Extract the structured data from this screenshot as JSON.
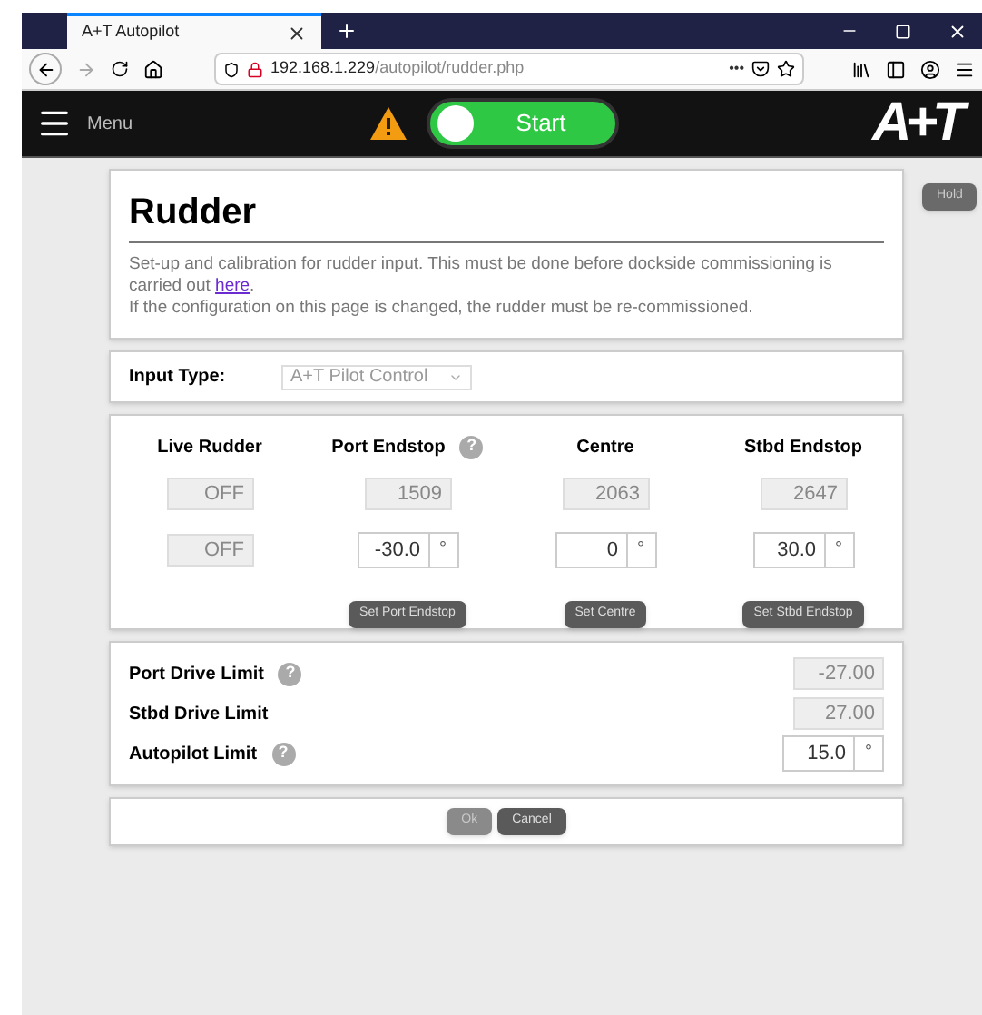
{
  "browser": {
    "tab_title": "A+T Autopilot",
    "url_host": "192.168.1.229",
    "url_path": "/autopilot/rudder.php",
    "url_more": "•••"
  },
  "header": {
    "menu_label": "Menu",
    "start_label": "Start",
    "start_on": false,
    "logo": "A+T"
  },
  "hold_button": "Hold",
  "intro": {
    "title": "Rudder",
    "text_before": "Set-up and calibration for rudder input. This must be done before dockside commissioning is carried out ",
    "link": "here",
    "text_after": ".",
    "note": "If the configuration on this page is changed, the rudder must be re-commissioned."
  },
  "input_type": {
    "label": "Input Type:",
    "value": "A+T Pilot Control"
  },
  "columns": [
    {
      "heading": "Live Rudder",
      "raw": "OFF",
      "angle": "OFF",
      "kind": "readout"
    },
    {
      "heading": "Port Endstop",
      "help": "?",
      "raw": "1509",
      "angle": "-30.0",
      "kind": "input",
      "unit": "°",
      "button": "Set Port Endstop"
    },
    {
      "heading": "Centre",
      "raw": "2063",
      "angle": "0",
      "kind": "input",
      "unit": "°",
      "button": "Set Centre"
    },
    {
      "heading": "Stbd Endstop",
      "raw": "2647",
      "angle": "30.0",
      "kind": "input",
      "unit": "°",
      "button": "Set Stbd Endstop"
    }
  ],
  "limits": [
    {
      "label": "Port Drive Limit",
      "help": "?",
      "value": "-27.00",
      "kind": "readout"
    },
    {
      "label": "Stbd Drive Limit",
      "value": "27.00",
      "kind": "readout"
    },
    {
      "label": "Autopilot Limit",
      "help": "?",
      "value": "15.0",
      "kind": "input",
      "unit": "°"
    }
  ],
  "actions": [
    {
      "label": "Ok",
      "disabled": true
    },
    {
      "label": "Cancel",
      "disabled": false
    }
  ]
}
